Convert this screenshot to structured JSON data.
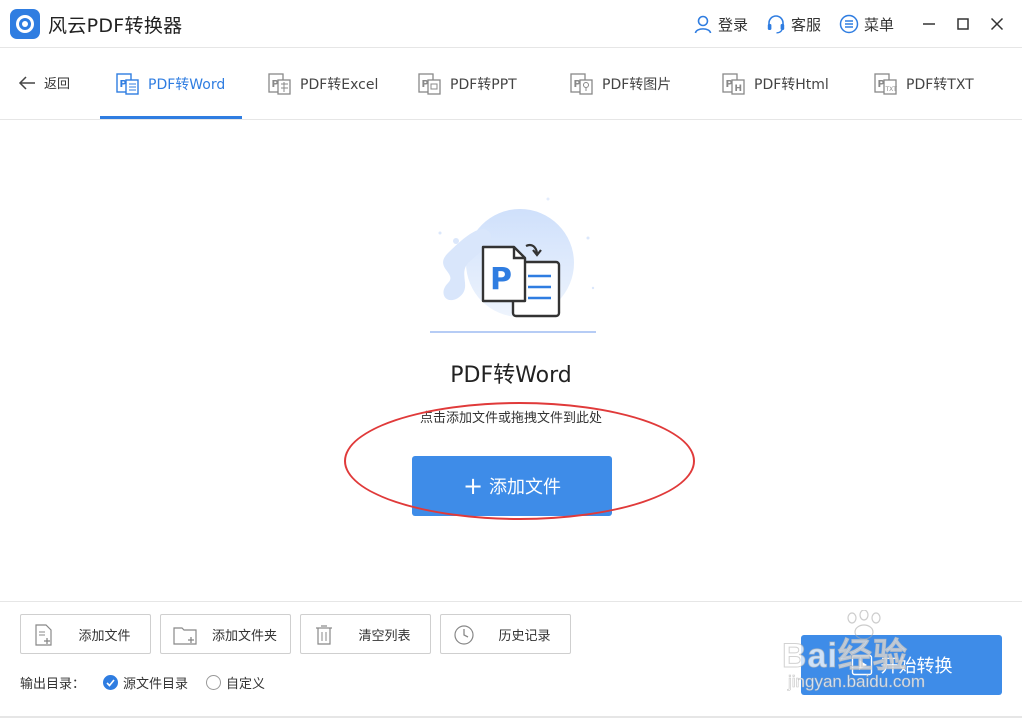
{
  "app": {
    "title": "风云PDF转换器"
  },
  "header": {
    "login_label": "登录",
    "service_label": "客服",
    "menu_label": "菜单"
  },
  "nav": {
    "back_label": "返回",
    "tabs": [
      {
        "label": "PDF转Word",
        "active": true
      },
      {
        "label": "PDF转Excel",
        "active": false
      },
      {
        "label": "PDF转PPT",
        "active": false
      },
      {
        "label": "PDF转图片",
        "active": false
      },
      {
        "label": "PDF转Html",
        "active": false
      },
      {
        "label": "PDF转TXT",
        "active": false
      }
    ]
  },
  "main": {
    "title": "PDF转Word",
    "hint": "点击添加文件或拖拽文件到此处",
    "add_file_label": "添加文件"
  },
  "toolbar": {
    "add_file_label": "添加文件",
    "add_folder_label": "添加文件夹",
    "clear_list_label": "清空列表",
    "history_label": "历史记录"
  },
  "output": {
    "label": "输出目录：",
    "options": [
      {
        "label": "源文件目录",
        "selected": true
      },
      {
        "label": "自定义",
        "selected": false
      }
    ]
  },
  "start_button_label": "开始转换",
  "watermark": {
    "brand": "Bai经验",
    "url": "jingyan.baidu.com"
  },
  "colors": {
    "accent": "#2f7de1",
    "button": "#3e8ce8",
    "annotation": "#e03a3a"
  }
}
